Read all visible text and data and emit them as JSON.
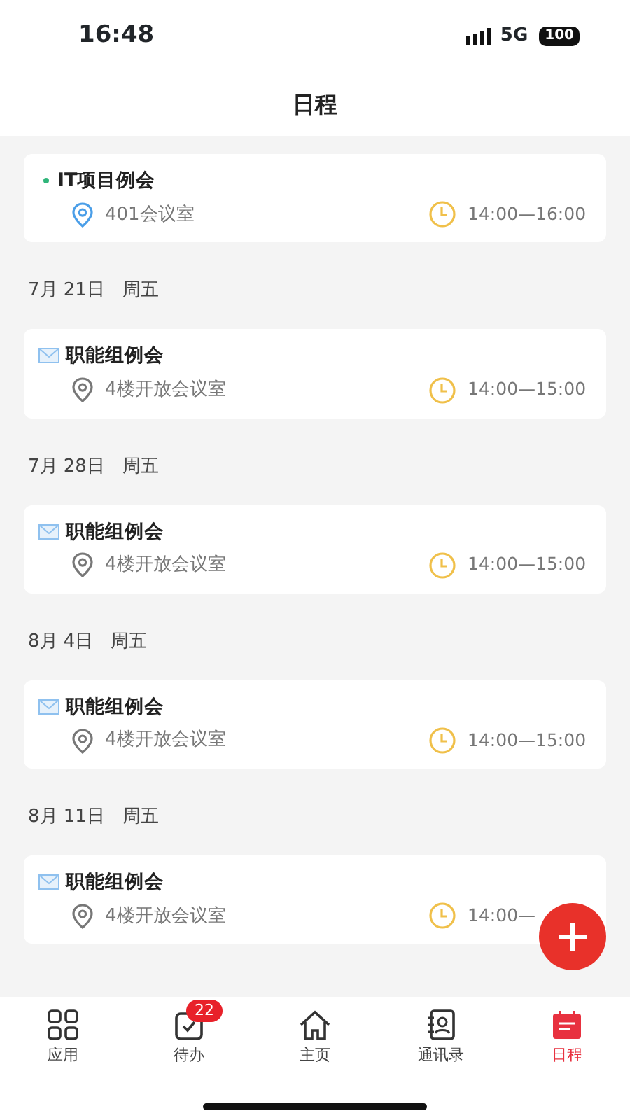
{
  "status_bar": {
    "time": "16:48",
    "network": "5G",
    "battery": "100"
  },
  "header": {
    "title": "日程"
  },
  "groups": [
    {
      "events": [
        {
          "kind": "dot",
          "title": "IT项目例会",
          "location": "401会议室",
          "time": "14:00—16:00"
        }
      ]
    },
    {
      "date": "7月 21日   周五",
      "events": [
        {
          "kind": "mail",
          "title": "职能组例会",
          "location": "4楼开放会议室",
          "time": "14:00—15:00"
        }
      ]
    },
    {
      "date": "7月 28日   周五",
      "events": [
        {
          "kind": "mail",
          "title": "职能组例会",
          "location": "4楼开放会议室",
          "time": "14:00—15:00"
        }
      ]
    },
    {
      "date": "8月 4日   周五",
      "events": [
        {
          "kind": "mail",
          "title": "职能组例会",
          "location": "4楼开放会议室",
          "time": "14:00—15:00"
        }
      ]
    },
    {
      "date": "8月 11日   周五",
      "events": [
        {
          "kind": "mail",
          "title": "职能组例会",
          "location": "4楼开放会议室",
          "time": "14:00—"
        }
      ]
    }
  ],
  "tabs": [
    {
      "kind": "apps",
      "label": "应用",
      "selected": false
    },
    {
      "kind": "todo",
      "label": "待办",
      "badge": "22",
      "selected": false
    },
    {
      "kind": "home",
      "label": "主页",
      "selected": false
    },
    {
      "kind": "contacts",
      "label": "通讯录",
      "selected": false
    },
    {
      "kind": "calendar",
      "label": "日程",
      "selected": true
    }
  ]
}
